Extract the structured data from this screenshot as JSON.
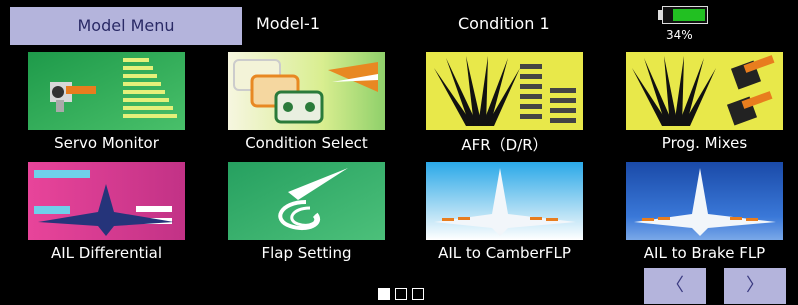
{
  "header": {
    "menu_title": "Model Menu",
    "model_name": "Model-1",
    "condition_name": "Condition 1",
    "battery": {
      "percent_label": "34%",
      "level": 0.8,
      "color": "#22c022"
    }
  },
  "tiles": [
    {
      "label": "Servo Monitor",
      "icon": "servo-monitor-icon"
    },
    {
      "label": "Condition Select",
      "icon": "condition-select-icon"
    },
    {
      "label": "AFR（D/R）",
      "icon": "afr-icon"
    },
    {
      "label": "Prog. Mixes",
      "icon": "prog-mixes-icon"
    },
    {
      "label": "AIL Differential",
      "icon": "ail-differential-icon"
    },
    {
      "label": "Flap Setting",
      "icon": "flap-setting-icon"
    },
    {
      "label": "AIL to CamberFLP",
      "icon": "ail-to-camber-flp-icon"
    },
    {
      "label": "AIL to Brake FLP",
      "icon": "ail-to-brake-flp-icon"
    }
  ],
  "pagination": {
    "pages": 3,
    "current": 1
  },
  "nav": {
    "prev_label": "〈",
    "next_label": "〉"
  },
  "colors": {
    "menu_tab": "#b4b4dc",
    "background": "#000000"
  }
}
